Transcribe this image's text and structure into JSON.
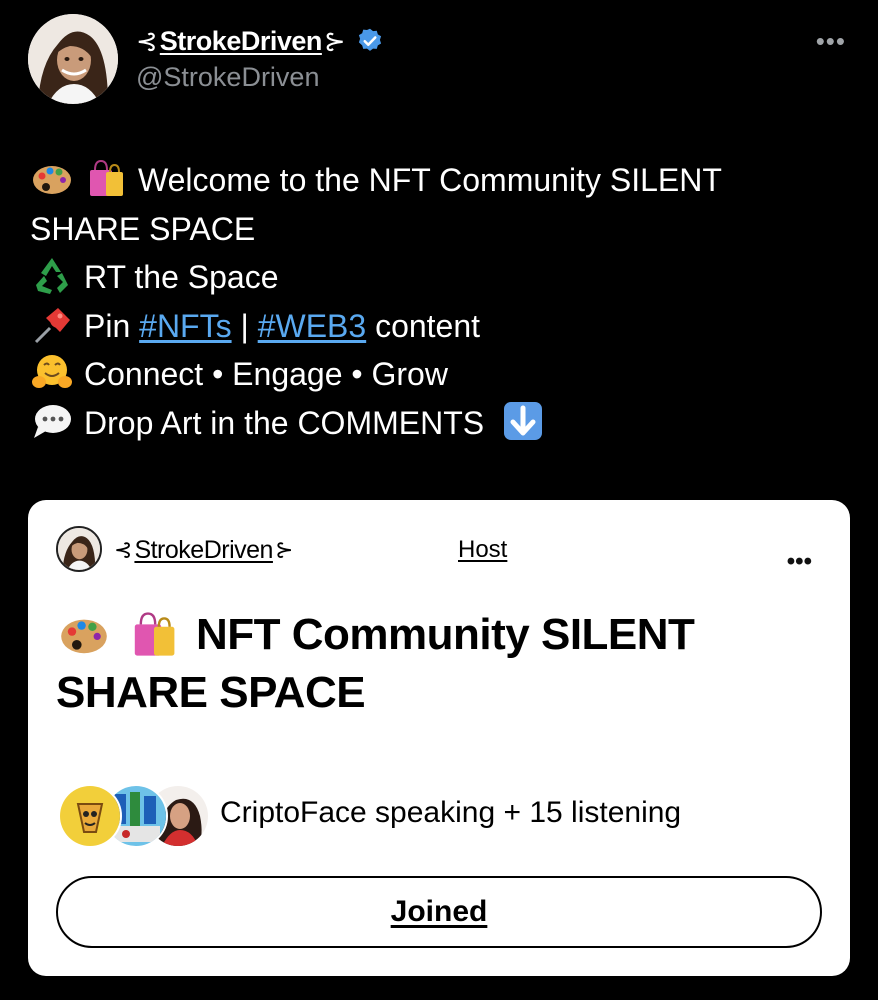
{
  "tweet": {
    "author": {
      "display_name": "StrokeDriven",
      "handle": "@StrokeDriven",
      "verified": true,
      "verified_color": "#4a99e9"
    },
    "more_icon": "more-horizontal-icon",
    "more_glyph": "•••",
    "lines": [
      {
        "icons": [
          "palette-emoji",
          "shopping-bags-emoji"
        ],
        "text": "Welcome to the NFT Community SILENT"
      },
      {
        "icons": [],
        "text": "SHARE SPACE"
      },
      {
        "icons": [
          "recycle-emoji"
        ],
        "text": "RT the Space"
      },
      {
        "icons": [
          "pushpin-emoji"
        ],
        "prefix": "Pin ",
        "hashtag1": "#NFTs",
        "separator": " | ",
        "hashtag2": "#WEB3",
        "suffix": " content"
      },
      {
        "icons": [
          "hugging-face-emoji"
        ],
        "text": "Connect • Engage • Grow"
      },
      {
        "icons": [
          "speech-bubble-emoji"
        ],
        "text": "Drop Art in the COMMENTS",
        "trailing_icon": "down-arrow-emoji"
      }
    ],
    "hashtag_color": "#5aa9f0"
  },
  "space_card": {
    "host_name": "StrokeDriven",
    "host_label": "Host",
    "more_glyph": "•••",
    "title": "NFT Community SILENT SHARE SPACE",
    "title_icons": [
      "palette-emoji",
      "shopping-bags-emoji"
    ],
    "participants_text": "CriptoFace speaking + 15 listening",
    "join_button_label": "Joined"
  },
  "colors": {
    "background": "#000000",
    "card_background": "#ffffff",
    "secondary_text": "#8b8f94"
  }
}
